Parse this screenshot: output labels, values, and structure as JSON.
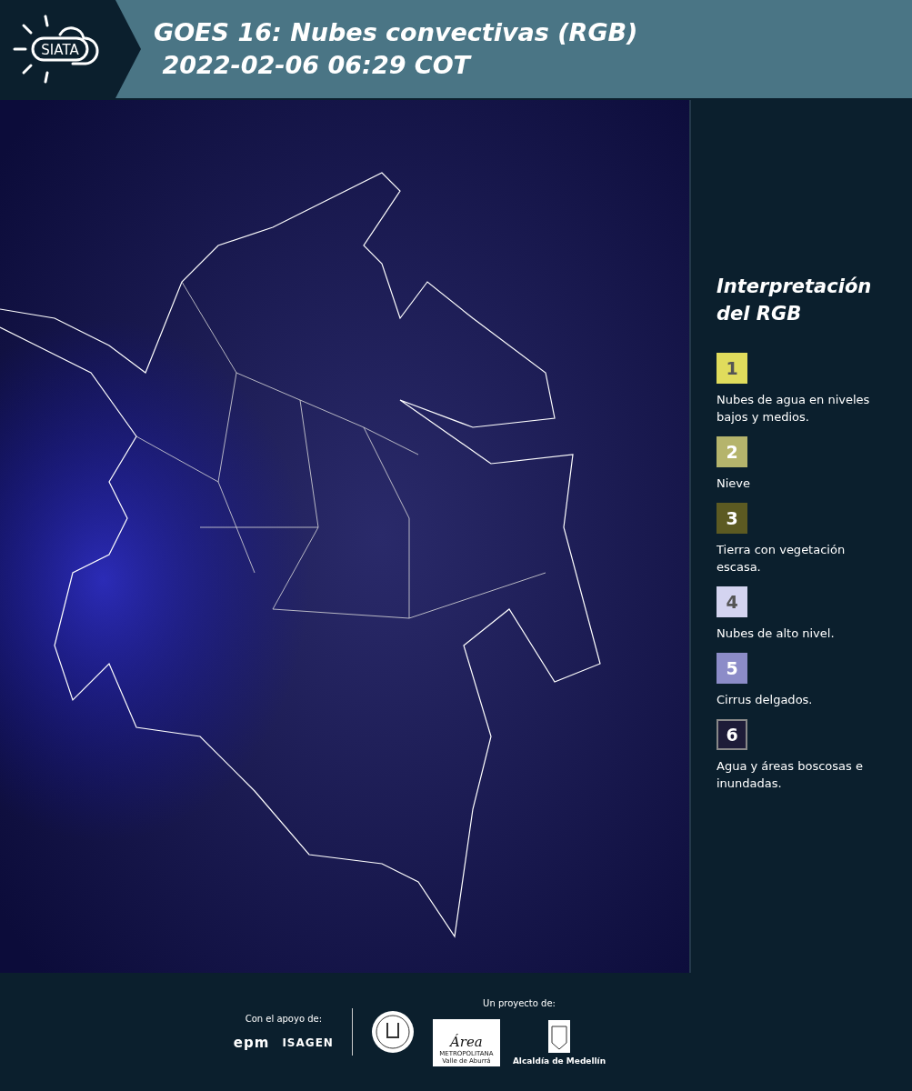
{
  "header": {
    "logo_text": "SIATA",
    "title_line_1": "GOES 16: Nubes convectivas (RGB)",
    "title_line_2": "2022-02-06 06:29 COT"
  },
  "legend": {
    "title": "Interpretación del RGB",
    "items": [
      {
        "number": "1",
        "color": "#e0dc5c",
        "text": "Nubes de agua en niveles bajos y medios."
      },
      {
        "number": "2",
        "color": "#b5b46c",
        "text": "Nieve"
      },
      {
        "number": "3",
        "color": "#5c5a22",
        "text": "Tierra con vegetación escasa."
      },
      {
        "number": "4",
        "color": "#d4d4f0",
        "text": "Nubes de alto nivel."
      },
      {
        "number": "5",
        "color": "#8c8cc8",
        "text": "Cirrus delgados."
      },
      {
        "number": "6",
        "color": "#1e1c38",
        "text": "Agua y áreas boscosas e inundadas."
      }
    ]
  },
  "footer": {
    "support_label": "Con el apoyo de:",
    "support_logos": [
      "epm",
      "ISAGEN"
    ],
    "project_label": "Un proyecto de:",
    "area_logo": {
      "name": "Área",
      "lines": [
        "METROPOLITANA",
        "Valle de Aburrá"
      ]
    },
    "city_logo_text": "Alcaldía de Medellín"
  }
}
